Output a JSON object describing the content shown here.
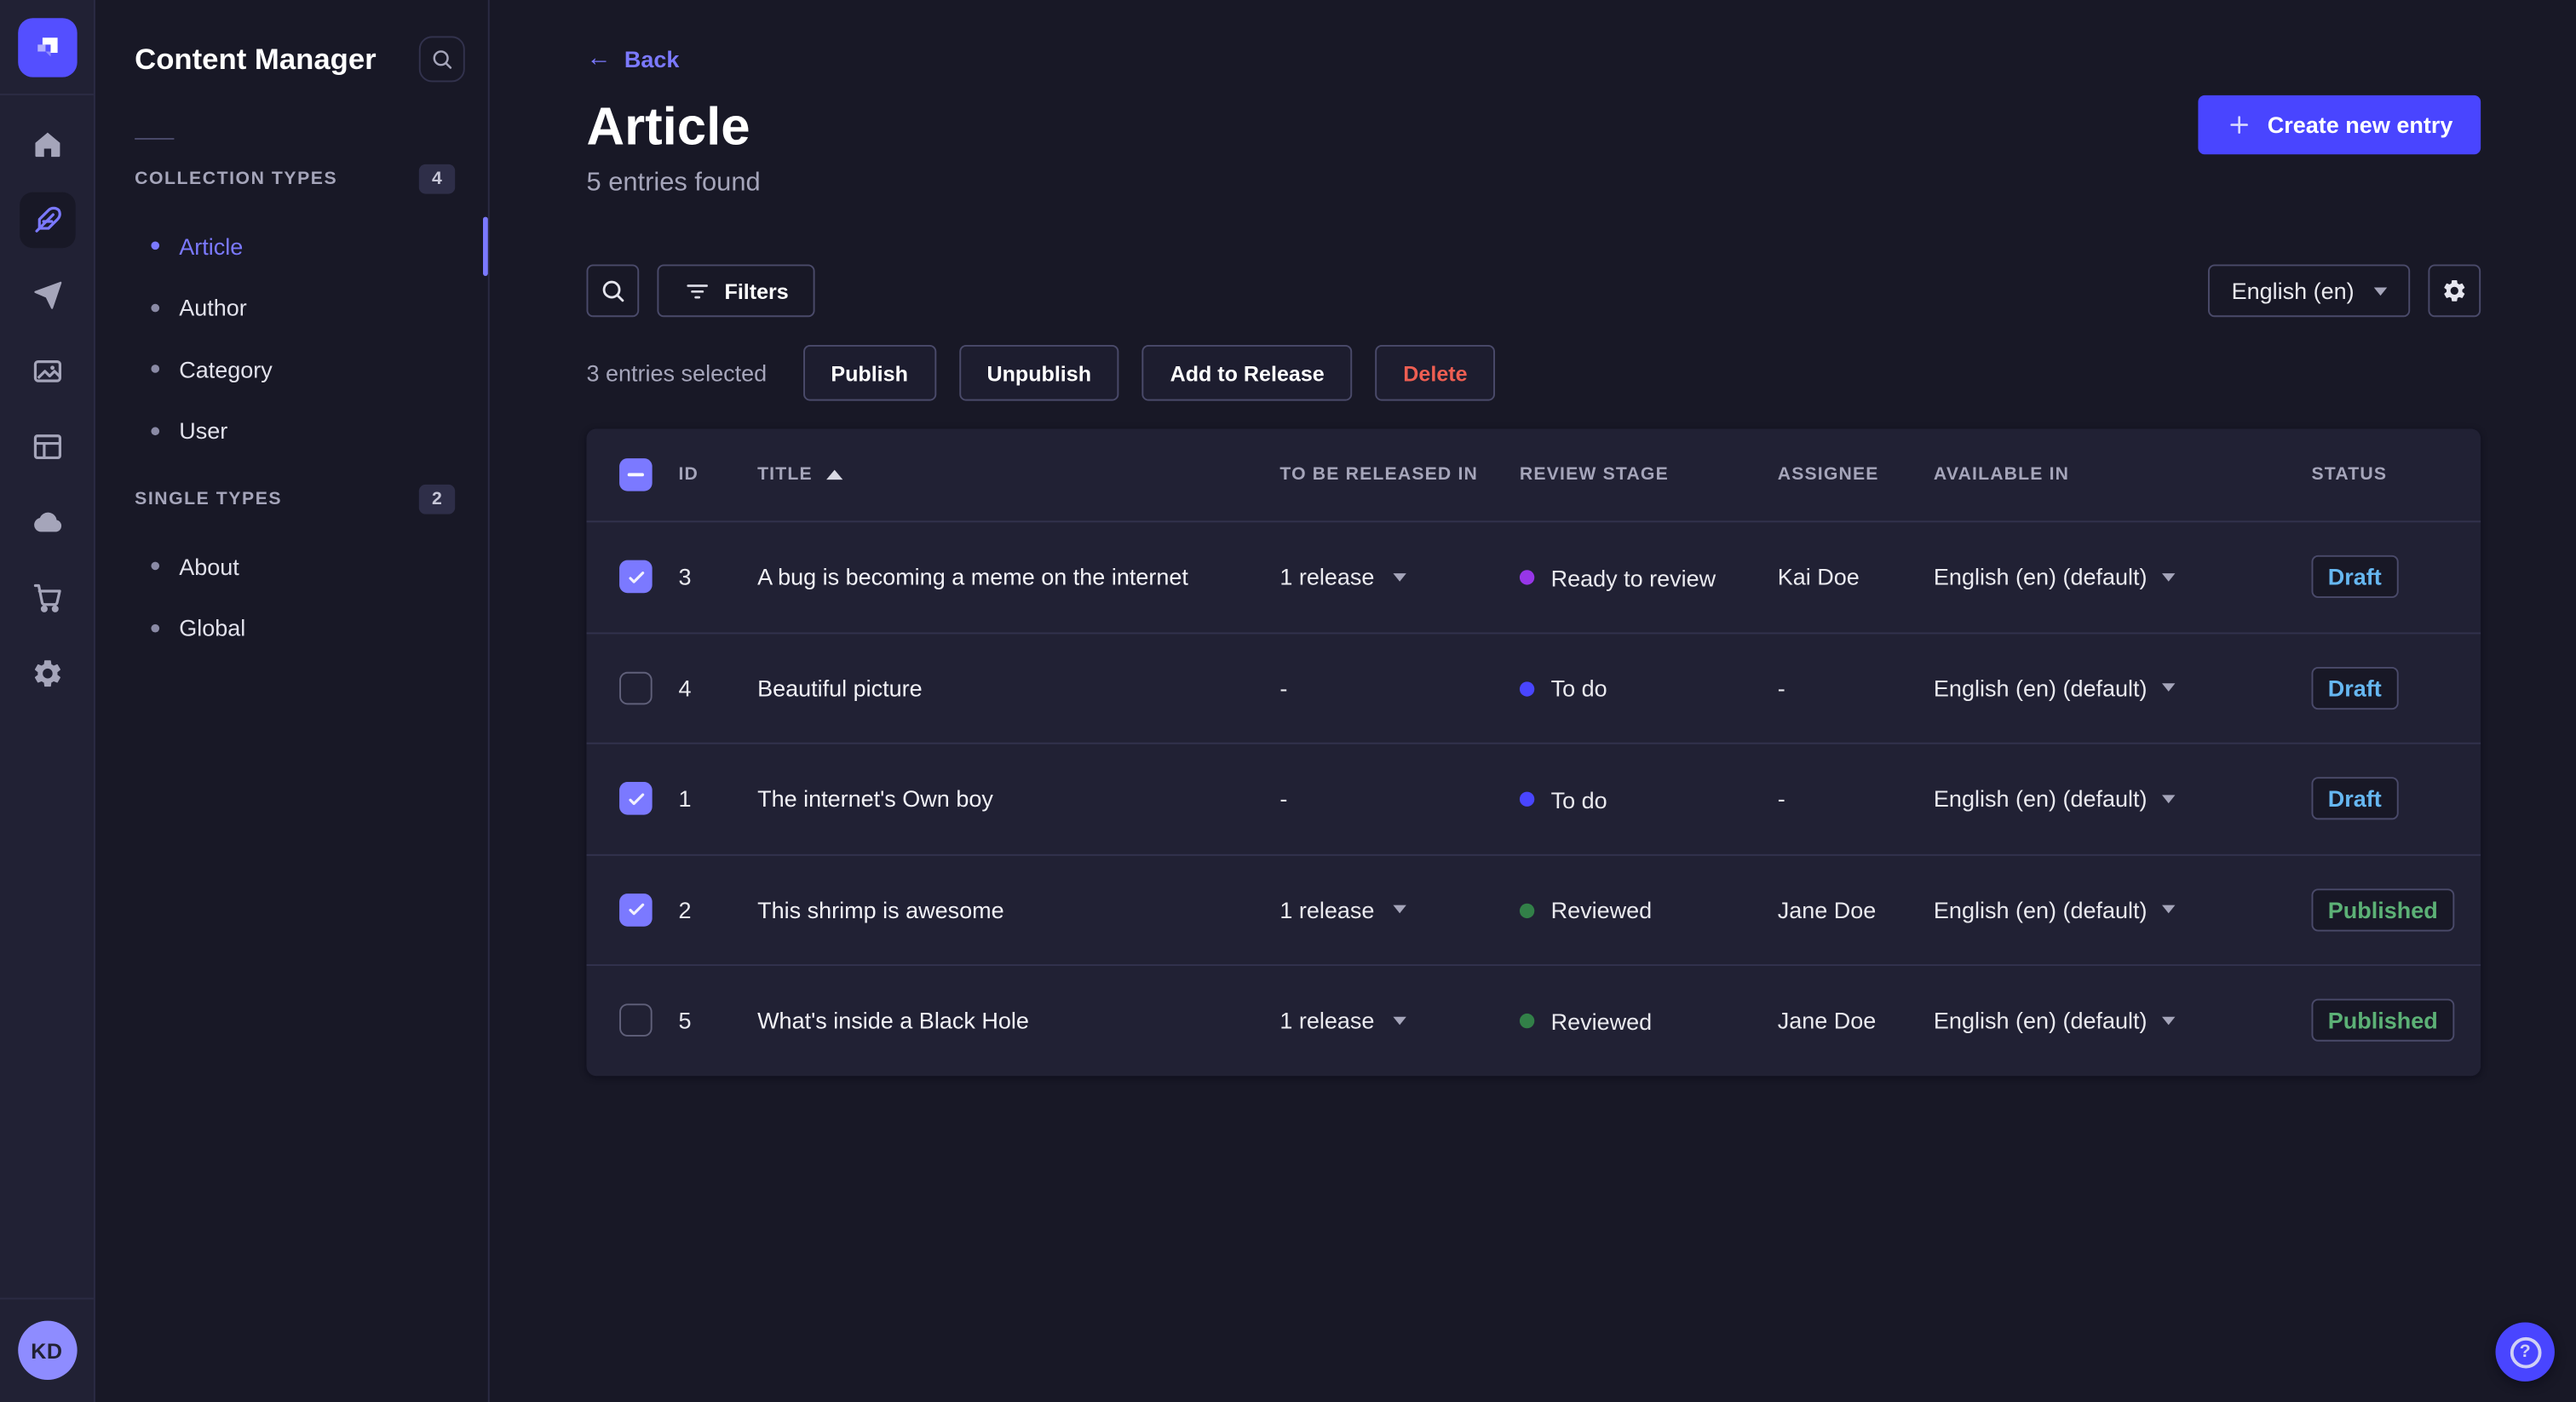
{
  "app": {
    "user_initials": "KD",
    "rail_icons": [
      {
        "icon": "home-icon",
        "active": false
      },
      {
        "icon": "feather-icon",
        "active": true
      },
      {
        "icon": "paper-plane-icon",
        "active": false
      },
      {
        "icon": "pictures-icon",
        "active": false
      },
      {
        "icon": "layout-icon",
        "active": false
      },
      {
        "icon": "cloud-icon",
        "active": false
      },
      {
        "icon": "cart-icon",
        "active": false
      },
      {
        "icon": "gear-icon",
        "active": false
      }
    ],
    "colors": {
      "primary": "#4945ff",
      "primary_light": "#7b79ff",
      "surface": "#212134",
      "background": "#181826",
      "border": "#32324d",
      "text_muted": "#a5a5ba",
      "danger": "#ee5e52",
      "success": "#5cb176",
      "draft_blue": "#66b7f1"
    }
  },
  "subnav": {
    "title": "Content Manager",
    "sections": [
      {
        "label": "COLLECTION TYPES",
        "count": "4",
        "items": [
          {
            "label": "Article",
            "active": true
          },
          {
            "label": "Author",
            "active": false
          },
          {
            "label": "Category",
            "active": false
          },
          {
            "label": "User",
            "active": false
          }
        ]
      },
      {
        "label": "SINGLE TYPES",
        "count": "2",
        "items": [
          {
            "label": "About",
            "active": false
          },
          {
            "label": "Global",
            "active": false
          }
        ]
      }
    ]
  },
  "header": {
    "back_label": "Back",
    "title": "Article",
    "subtitle": "5 entries found",
    "create_button_label": "Create new entry"
  },
  "toolbar": {
    "filters_label": "Filters",
    "locale_value": "English (en)"
  },
  "selection": {
    "summary": "3 entries selected",
    "actions": [
      {
        "label": "Publish",
        "variant": "default"
      },
      {
        "label": "Unpublish",
        "variant": "default"
      },
      {
        "label": "Add to Release",
        "variant": "default"
      },
      {
        "label": "Delete",
        "variant": "danger"
      }
    ]
  },
  "table": {
    "columns": [
      "ID",
      "TITLE",
      "TO BE RELEASED IN",
      "REVIEW STAGE",
      "ASSIGNEE",
      "AVAILABLE IN",
      "STATUS"
    ],
    "sort": {
      "column": "TITLE",
      "direction": "asc"
    },
    "select_all_state": "indeterminate",
    "rows": [
      {
        "selected": true,
        "id": "3",
        "title": "A bug is becoming a meme on the internet",
        "to_be_released_in": "1 release",
        "review_stage": "Ready to review",
        "review_stage_color": "#9736e8",
        "assignee": "Kai Doe",
        "available_in": "English (en) (default)",
        "status": "Draft"
      },
      {
        "selected": false,
        "id": "4",
        "title": "Beautiful picture",
        "to_be_released_in": "-",
        "review_stage": "To do",
        "review_stage_color": "#4945ff",
        "assignee": "-",
        "available_in": "English (en) (default)",
        "status": "Draft"
      },
      {
        "selected": true,
        "id": "1",
        "title": "The internet's Own boy",
        "to_be_released_in": "-",
        "review_stage": "To do",
        "review_stage_color": "#4945ff",
        "assignee": "-",
        "available_in": "English (en) (default)",
        "status": "Draft"
      },
      {
        "selected": true,
        "id": "2",
        "title": "This shrimp is awesome",
        "to_be_released_in": "1 release",
        "review_stage": "Reviewed",
        "review_stage_color": "#328048",
        "assignee": "Jane Doe",
        "available_in": "English (en) (default)",
        "status": "Published"
      },
      {
        "selected": false,
        "id": "5",
        "title": "What's inside a Black Hole",
        "to_be_released_in": "1 release",
        "review_stage": "Reviewed",
        "review_stage_color": "#328048",
        "assignee": "Jane Doe",
        "available_in": "English (en) (default)",
        "status": "Published"
      }
    ]
  },
  "help": {
    "tooltip": "?"
  }
}
